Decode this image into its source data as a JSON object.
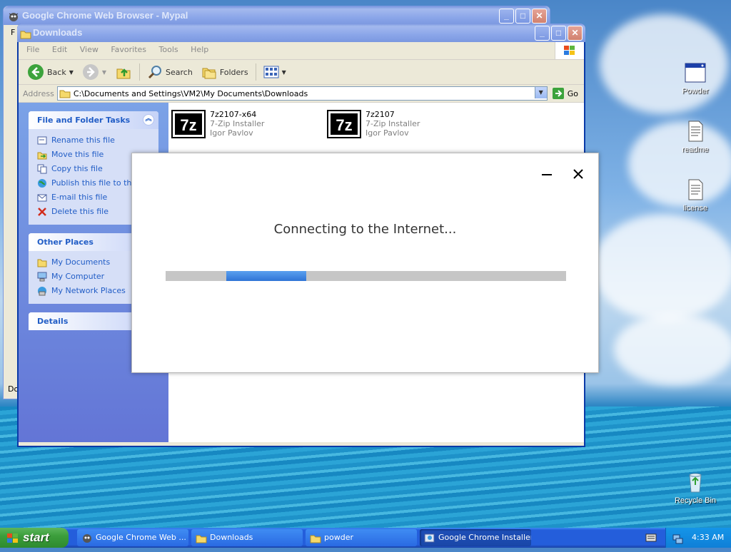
{
  "desktop": {
    "icons": [
      {
        "label": "Powder",
        "icon": "window-app-icon"
      },
      {
        "label": "readme",
        "icon": "text-document-icon"
      },
      {
        "label": "license",
        "icon": "text-document-icon"
      },
      {
        "label": "Recycle Bin",
        "icon": "recycle-bin-icon"
      }
    ]
  },
  "chrome_window": {
    "title": "Google Chrome Web Browser - Mypal",
    "left_strip_texts": [
      "F",
      "Do"
    ]
  },
  "explorer": {
    "title": "Downloads",
    "menu": [
      "File",
      "Edit",
      "View",
      "Favorites",
      "Tools",
      "Help"
    ],
    "toolbar": {
      "back": "Back",
      "search": "Search",
      "folders": "Folders"
    },
    "address_label": "Address",
    "address_value": "C:\\Documents and Settings\\VM2\\My Documents\\Downloads",
    "go_label": "Go",
    "tasks_title": "File and Folder Tasks",
    "tasks": [
      {
        "label": "Rename this file",
        "icon": "rename-icon"
      },
      {
        "label": "Move this file",
        "icon": "move-icon"
      },
      {
        "label": "Copy this file",
        "icon": "copy-icon"
      },
      {
        "label": "Publish this file to the W",
        "icon": "globe-icon"
      },
      {
        "label": "E-mail this file",
        "icon": "email-icon"
      },
      {
        "label": "Delete this file",
        "icon": "delete-icon"
      }
    ],
    "places_title": "Other Places",
    "places": [
      {
        "label": "My Documents",
        "icon": "folder-icon"
      },
      {
        "label": "My Computer",
        "icon": "computer-icon"
      },
      {
        "label": "My Network Places",
        "icon": "network-icon"
      }
    ],
    "details_title": "Details",
    "files": [
      {
        "name": "7z2107-x64",
        "type": "7-Zip Installer",
        "author": "Igor Pavlov"
      },
      {
        "name": "7z2107",
        "type": "7-Zip Installer",
        "author": "Igor Pavlov"
      }
    ]
  },
  "installer": {
    "message": "Connecting to the Internet...",
    "progress_segment_start": 0.152,
    "progress_segment_end": 0.352,
    "accent": "#3b82e0"
  },
  "taskbar": {
    "start_label": "start",
    "buttons": [
      {
        "label": "Google Chrome Web ...",
        "icon": "mypal-icon"
      },
      {
        "label": "Downloads",
        "icon": "folder-icon"
      },
      {
        "label": "powder",
        "icon": "folder-icon"
      },
      {
        "label": "Google Chrome Installer",
        "icon": "installer-icon",
        "active": true
      }
    ],
    "clock": "4:33 AM"
  }
}
